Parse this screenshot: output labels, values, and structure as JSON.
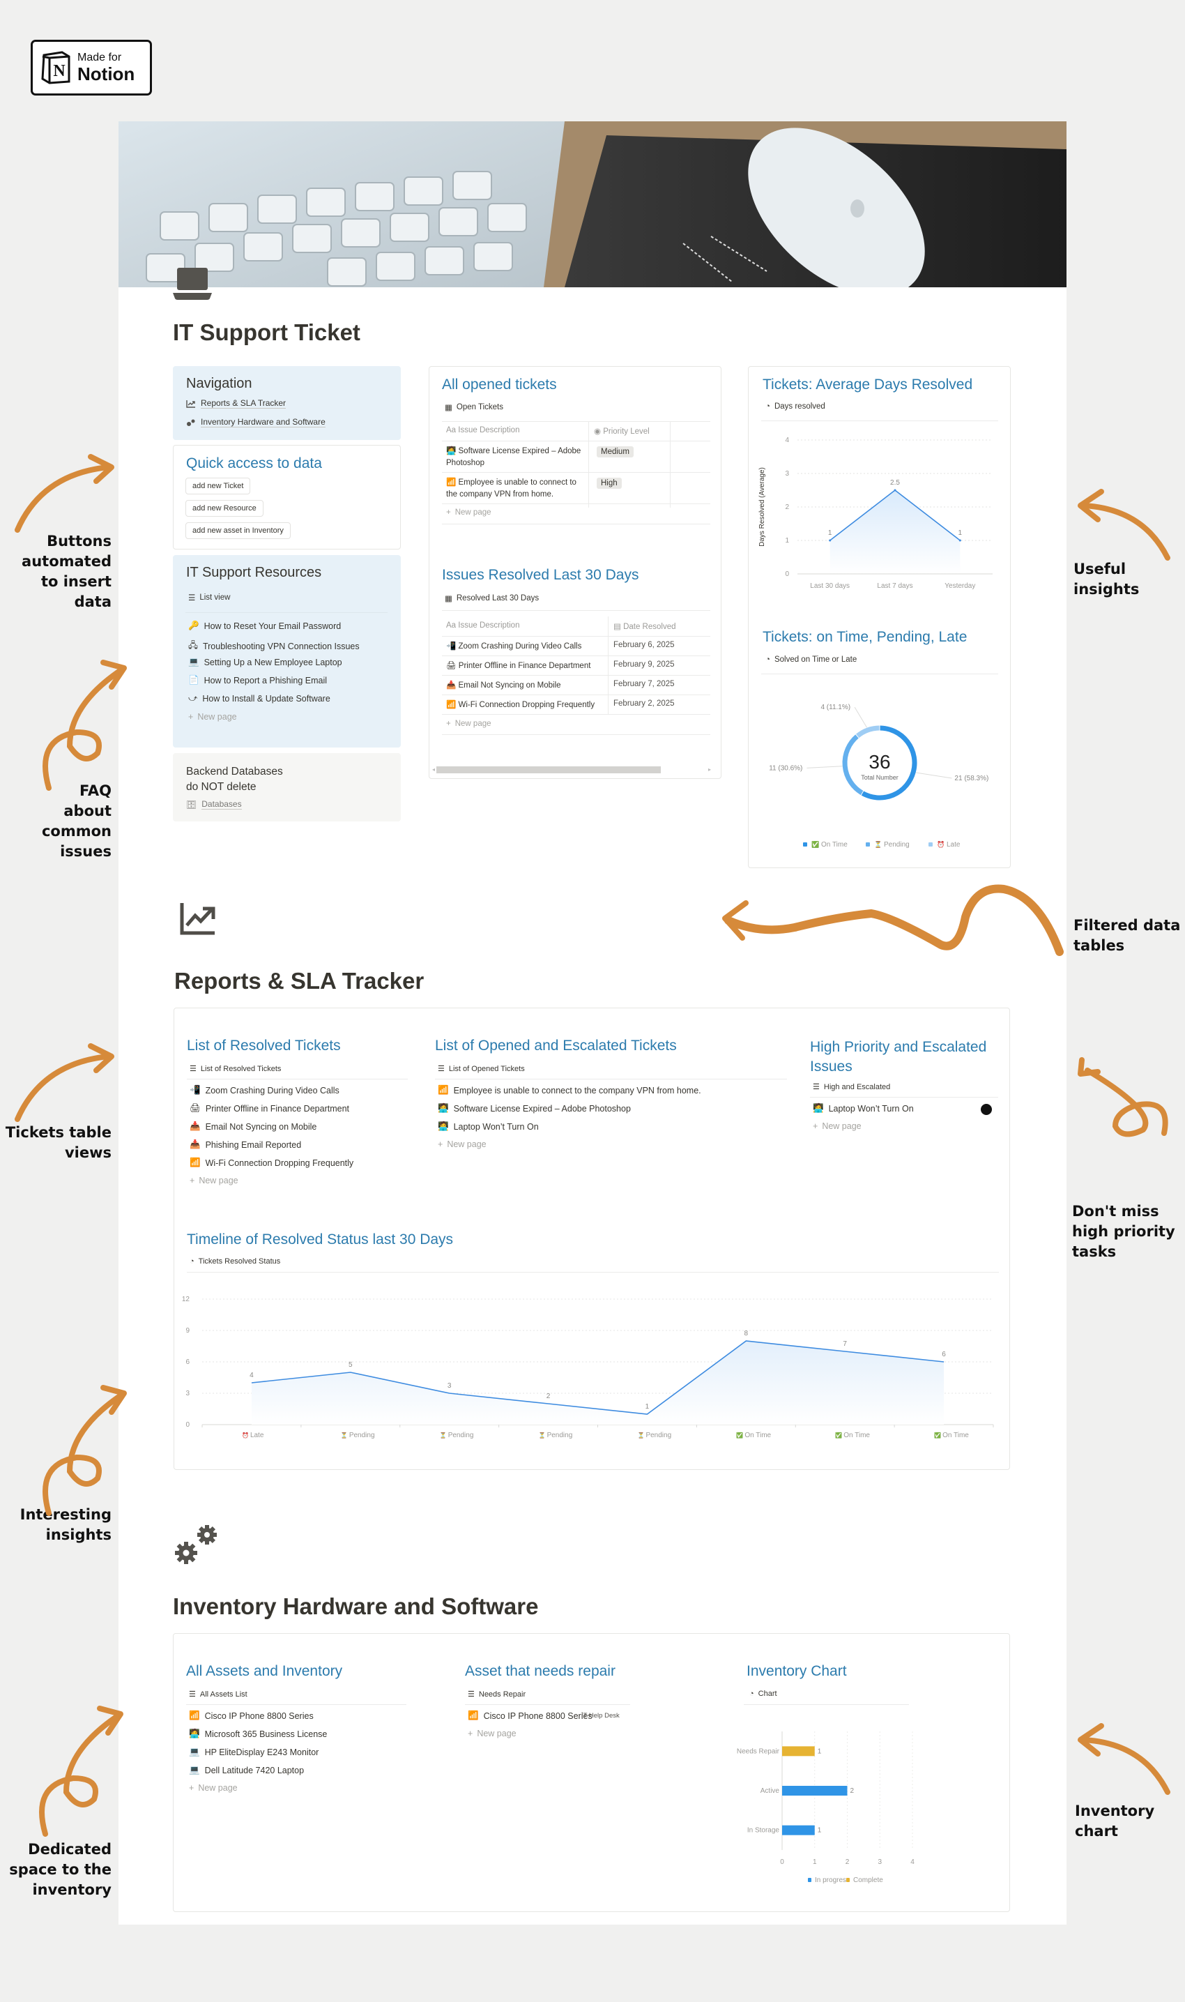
{
  "badge": {
    "line1": "Made for",
    "line2": "Notion"
  },
  "annotations": {
    "left": [
      "Buttons\nautomated\nto insert data",
      "FAQ\nabout\ncommon\nissues",
      "Tickets table\nviews",
      "Interesting\ninsights",
      "Dedicated\nspace to the\ninventory"
    ],
    "right": [
      "Useful\ninsights",
      "Filtered data\ntables",
      "Don't miss\nhigh priority\ntasks",
      "Inventory\nchart"
    ]
  },
  "page": {
    "title": "IT Support Ticket",
    "icon": "laptop-icon"
  },
  "navigation": {
    "title": "Navigation",
    "links": [
      {
        "label": "Reports & SLA Tracker",
        "icon": "trending-up-icon"
      },
      {
        "label": "Inventory Hardware and Software",
        "icon": "gears-icon"
      }
    ]
  },
  "quick_access": {
    "title": "Quick access to data",
    "buttons": [
      "add new Ticket",
      "add new Resource",
      "add new asset in Inventory"
    ]
  },
  "resources": {
    "title": "IT Support Resources",
    "view": "List view",
    "items": [
      {
        "label": "How to Reset Your Email Password",
        "icon": "key-icon"
      },
      {
        "label": "Troubleshooting VPN Connection Issues",
        "icon": "network-icon"
      },
      {
        "label": "Setting Up a New Employee Laptop",
        "icon": "laptop-icon"
      },
      {
        "label": "How to Report a Phishing Email",
        "icon": "document-icon"
      },
      {
        "label": "How to Install & Update Software",
        "icon": "workflow-icon"
      }
    ],
    "new_page": "New page"
  },
  "backend": {
    "title": "Backend Databases\ndo NOT delete",
    "link": "Databases"
  },
  "open_tickets": {
    "title": "All opened tickets",
    "view": "Open Tickets",
    "columns": [
      "Issue Description",
      "Priority Level"
    ],
    "rows": [
      {
        "issue": "Software License Expired – Adobe Photoshop",
        "priority": "Medium",
        "icon": "technologist-icon"
      },
      {
        "issue": "Employee is unable to connect to the company VPN from home.",
        "priority": "High",
        "icon": "signal-icon"
      }
    ],
    "new_page": "New page"
  },
  "resolved_30": {
    "title": "Issues Resolved Last 30 Days",
    "view": "Resolved Last 30 Days",
    "columns": [
      "Issue Description",
      "Date Resolved"
    ],
    "rows": [
      {
        "issue": "Zoom Crashing During Video Calls",
        "date": "February 6, 2025",
        "icon": "mobile-icon"
      },
      {
        "issue": "Printer Offline in Finance Department",
        "date": "February 9, 2025",
        "icon": "printer-icon"
      },
      {
        "issue": "Email Not Syncing on Mobile",
        "date": "February 7, 2025",
        "icon": "inbox-icon"
      },
      {
        "issue": "Wi-Fi Connection Dropping Frequently",
        "date": "February 2, 2025",
        "icon": "signal-icon"
      }
    ],
    "new_page": "New page"
  },
  "avg_days": {
    "title": "Tickets: Average Days Resolved",
    "view": "Days resolved"
  },
  "status_donut": {
    "title": "Tickets: on Time, Pending, Late",
    "view": "Solved on Time or Late",
    "center_value": "36",
    "center_label": "Total Number"
  },
  "reports": {
    "title": "Reports & SLA Tracker",
    "resolved_list": {
      "title": "List of Resolved Tickets",
      "view": "List of Resolved Tickets",
      "items": [
        {
          "label": "Zoom Crashing During Video Calls",
          "icon": "mobile-icon"
        },
        {
          "label": "Printer Offline in Finance Department",
          "icon": "printer-icon"
        },
        {
          "label": "Email Not Syncing on Mobile",
          "icon": "inbox-icon"
        },
        {
          "label": "Phishing Email Reported",
          "icon": "inbox-icon"
        },
        {
          "label": "Wi-Fi Connection Dropping Frequently",
          "icon": "signal-icon"
        }
      ],
      "new_page": "New page"
    },
    "opened_list": {
      "title": "List of Opened and Escalated Tickets",
      "view": "List of Opened Tickets",
      "items": [
        {
          "label": "Employee is unable to connect to the company VPN from home.",
          "icon": "signal-icon"
        },
        {
          "label": "Software License Expired – Adobe Photoshop",
          "icon": "technologist-icon"
        },
        {
          "label": "Laptop Won’t Turn On",
          "icon": "technologist-icon"
        }
      ],
      "new_page": "New page"
    },
    "high_priority": {
      "title": "High Priority and Escalated Issues",
      "view": "High and Escalated",
      "items": [
        {
          "label": "Laptop Won’t Turn On",
          "icon": "technologist-icon"
        }
      ],
      "new_page": "New page"
    },
    "timeline": {
      "title": "Timeline of Resolved Status last 30 Days",
      "view": "Tickets Resolved Status"
    }
  },
  "inventory": {
    "title": "Inventory Hardware and Software",
    "all_assets": {
      "title": "All Assets and Inventory",
      "view": "All Assets List",
      "items": [
        {
          "label": "Cisco IP Phone 8800 Series",
          "icon": "signal-icon"
        },
        {
          "label": "Microsoft 365 Business License",
          "icon": "technologist-icon"
        },
        {
          "label": "HP EliteDisplay E243 Monitor",
          "icon": "laptop-icon"
        },
        {
          "label": "Dell Latitude 7420 Laptop",
          "icon": "laptop-icon"
        }
      ],
      "new_page": "New page"
    },
    "needs_repair": {
      "title": "Asset that needs repair",
      "view": "Needs Repair",
      "items": [
        {
          "label": "Cisco IP Phone 8800 Series",
          "icon": "signal-icon",
          "property": "IT Help Desk"
        }
      ],
      "new_page": "New page"
    },
    "chart_card": {
      "title": "Inventory Chart",
      "view": "Chart"
    }
  },
  "colors": {
    "accent": "#2c7bad",
    "arrow": "#d68a3a",
    "line": "#3d8be0",
    "bar_blue": "#2f94e6",
    "bar_yellow": "#e6b332"
  },
  "chart_data": [
    {
      "type": "line",
      "title": "Days resolved",
      "categories": [
        "Last 30 days",
        "Last 7 days",
        "Yesterday"
      ],
      "values": [
        1,
        2.5,
        1
      ],
      "xlabel": "",
      "ylabel": "Days Resolved (Average)",
      "ylim": [
        0,
        4
      ],
      "yticks": [
        0,
        1,
        2,
        3,
        4
      ],
      "grid": true
    },
    {
      "type": "pie",
      "title": "Solved on Time or Late",
      "categories": [
        "On Time",
        "Pending",
        "Late"
      ],
      "values": [
        21,
        11,
        4
      ],
      "labels": [
        "21 (58.3%)",
        "11 (30.6%)",
        "4 (11.1%)"
      ],
      "colors": [
        "#2f94e6",
        "#64b0ee",
        "#9fcdf4"
      ],
      "total": 36,
      "legend": "bottom"
    },
    {
      "type": "area",
      "title": "Tickets Resolved Status",
      "categories": [
        "Late",
        "Pending",
        "Pending",
        "Pending",
        "Pending",
        "On Time",
        "On Time",
        "On Time"
      ],
      "values": [
        4,
        5,
        3,
        2,
        1,
        8,
        7,
        6
      ],
      "ylim": [
        0,
        12
      ],
      "yticks": [
        0,
        3,
        6,
        9,
        12
      ],
      "grid": true
    },
    {
      "type": "bar",
      "orientation": "horizontal",
      "title": "Chart",
      "categories": [
        "Needs Repair",
        "Active",
        "In Storage"
      ],
      "values": [
        1,
        2,
        1
      ],
      "series_of_bar": [
        "Complete",
        "In progress",
        "In progress"
      ],
      "legend_entries": [
        "In progress",
        "Complete"
      ],
      "xlim": [
        0,
        4
      ],
      "xticks": [
        0,
        1,
        2,
        3,
        4
      ],
      "legend": "bottom"
    }
  ]
}
